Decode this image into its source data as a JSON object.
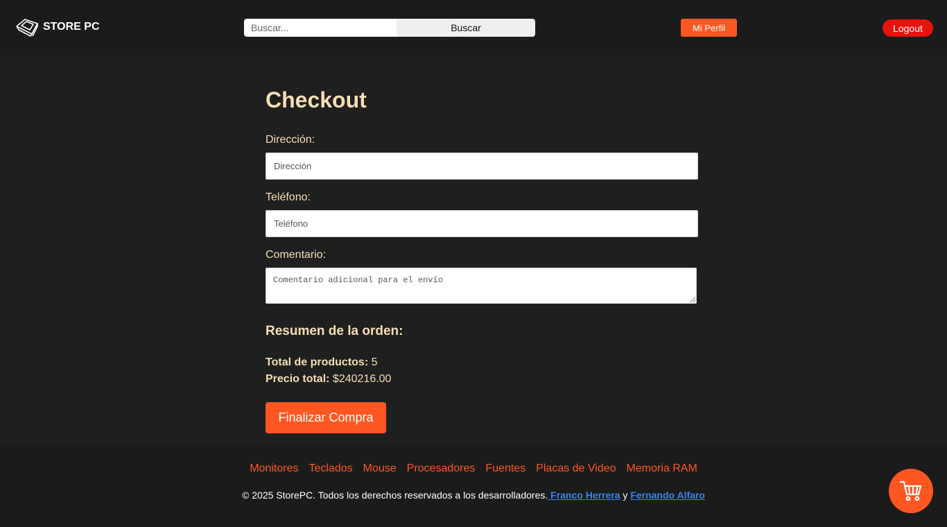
{
  "header": {
    "brand": "STORE PC",
    "logo_icon": "keycap-logo-icon",
    "search": {
      "placeholder": "Buscar...",
      "value": ""
    },
    "search_button": "Buscar",
    "profile_button": "Mi Perfil",
    "logout_button": "Logout"
  },
  "checkout": {
    "title": "Checkout",
    "address": {
      "label": "Dirección:",
      "placeholder": "Dirección",
      "value": ""
    },
    "phone": {
      "label": "Teléfono:",
      "placeholder": "Teléfono",
      "value": ""
    },
    "comment": {
      "label": "Comentario:",
      "placeholder": "Comentario adicional para el envío",
      "value": ""
    }
  },
  "summary": {
    "title": "Resumen de la orden:",
    "total_products_label": "Total de productos:",
    "total_products_value": "5",
    "total_price_label": "Precio total:",
    "total_price_value": "$240216.00",
    "submit_button": "Finalizar Compra"
  },
  "footer": {
    "nav": [
      "Monitores",
      "Teclados",
      "Mouse",
      "Procesadores",
      "Fuentes",
      "Placas de Video",
      "Memoria RAM"
    ],
    "copyright_text": "© 2025 StorePC. Todos los derechos reservados a los desarrolladores.",
    "author1": " Franco Herrera",
    "conjunction": "y",
    "author2": "Fernando Alfaro"
  },
  "cart": {
    "icon": "shopping-cart-icon"
  },
  "colors": {
    "background": "#1f1f1f",
    "header_bg": "#1b1b1b",
    "accent": "#ff5722",
    "logout": "#e8120c",
    "text": "#f5deb3",
    "link": "#3b82f6"
  }
}
